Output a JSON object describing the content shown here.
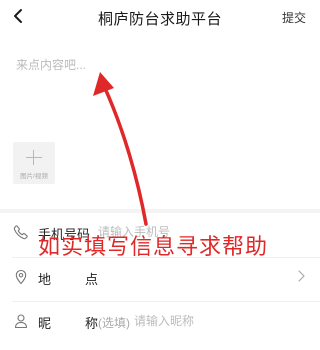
{
  "nav": {
    "title": "桐庐防台求助平台",
    "submit_label": "提交",
    "back_icon": "chevron-left-icon"
  },
  "content": {
    "placeholder": "来点内容吧...",
    "media_add_label": "图片/视频"
  },
  "form": {
    "phone": {
      "label": "手机号码",
      "placeholder": "请输入手机号",
      "icon": "phone-icon"
    },
    "location": {
      "label_left": "地",
      "label_right": "点",
      "icon": "location-pin-icon"
    },
    "nickname": {
      "label_left": "昵",
      "label_right": "称",
      "prefix": "(选填)",
      "placeholder": "请输入昵称",
      "icon": "user-icon"
    }
  },
  "annotation": {
    "text": "如实填写信息寻求帮助",
    "color": "#e02828"
  }
}
